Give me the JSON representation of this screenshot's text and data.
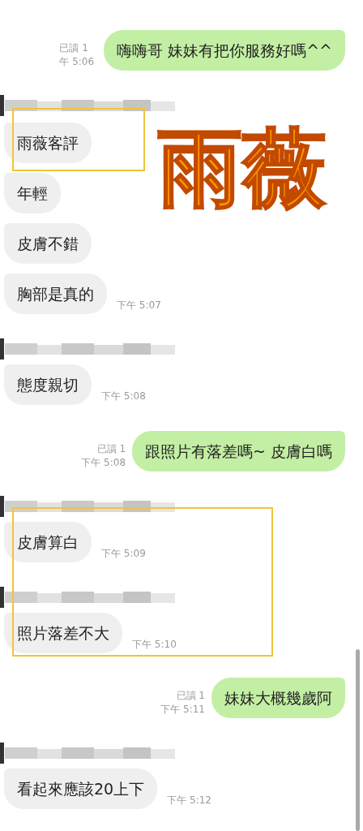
{
  "caption": "雨薇",
  "blocks": [
    {
      "framed": false,
      "messages": [
        {
          "kind": "sent",
          "text": "嗨嗨哥 妹妹有把你服務好嗎^^",
          "read": "已讀 1",
          "time": "午 5:06"
        },
        {
          "kind": "name"
        }
      ]
    },
    {
      "framed": true,
      "messages": [
        {
          "kind": "received",
          "text": "雨薇客評"
        }
      ]
    },
    {
      "framed": false,
      "messages": [
        {
          "kind": "received",
          "text": "年輕"
        },
        {
          "kind": "received",
          "text": "皮膚不錯"
        },
        {
          "kind": "received",
          "text": "胸部是真的",
          "time": "下午 5:07"
        },
        {
          "kind": "name"
        },
        {
          "kind": "received",
          "text": "態度親切",
          "time": "下午 5:08"
        },
        {
          "kind": "sent",
          "text": "跟照片有落差嗎~ 皮膚白嗎",
          "read": "已讀 1",
          "time": "下午 5:08"
        }
      ]
    },
    {
      "framed": true,
      "messages": [
        {
          "kind": "name"
        },
        {
          "kind": "received",
          "text": "皮膚算白",
          "time": "下午 5:09"
        },
        {
          "kind": "name"
        },
        {
          "kind": "received",
          "text": "照片落差不大",
          "time": "下午 5:10"
        }
      ]
    },
    {
      "framed": false,
      "messages": [
        {
          "kind": "sent",
          "text": "妹妹大概幾歲阿",
          "read": "已讀 1",
          "time": "下午 5:11"
        },
        {
          "kind": "name"
        },
        {
          "kind": "received",
          "text": "看起來應該20上下",
          "time": "下午 5:12"
        }
      ]
    }
  ]
}
